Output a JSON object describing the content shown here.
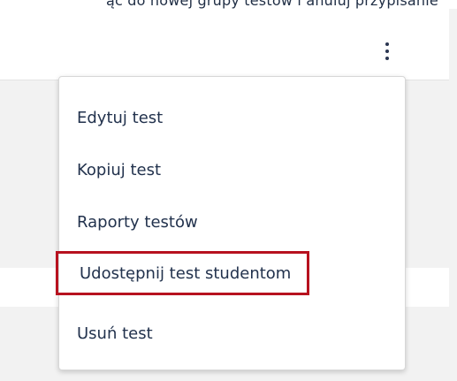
{
  "top_strip_text": "ąc do nowej grupy testów i anuluj przypisanie",
  "menu": {
    "items": [
      {
        "label": "Edytuj test"
      },
      {
        "label": "Kopiuj test"
      },
      {
        "label": "Raporty testów"
      },
      {
        "label": "Udostępnij test studentom",
        "highlighted": true
      },
      {
        "label": "Usuń test"
      }
    ]
  },
  "colors": {
    "menu_text": "#22324d",
    "highlight_border": "#b7121f",
    "page_background": "#f2f2f2",
    "menu_background": "#ffffff"
  },
  "icons": {
    "more_options": "kebab-vertical-dots"
  }
}
